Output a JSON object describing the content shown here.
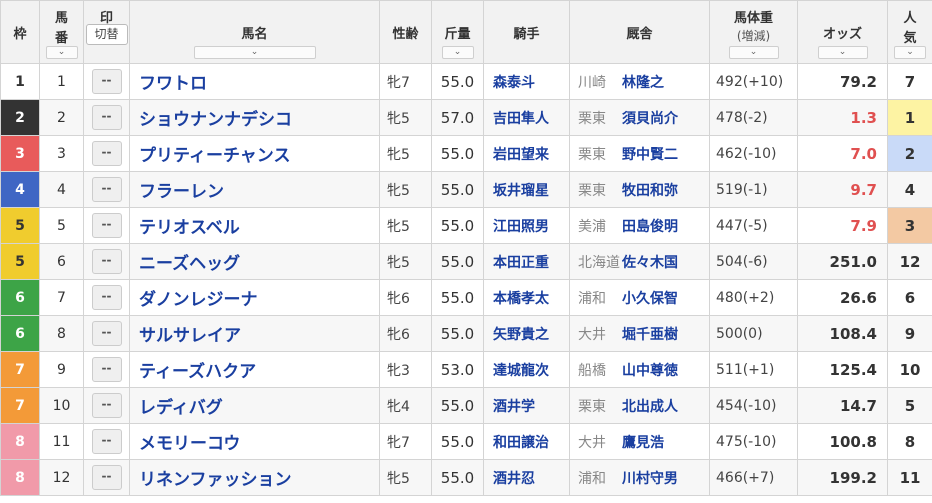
{
  "header": {
    "waku": "枠",
    "umaban_1": "馬",
    "umaban_2": "番",
    "mark": "印",
    "mark_toggle": "切替",
    "horse": "馬名",
    "sexage": "性齢",
    "weight": "斤量",
    "jockey": "騎手",
    "stable": "厩舎",
    "body_1": "馬体重",
    "body_2": "(増減)",
    "odds": "オッズ",
    "pop_1": "人",
    "pop_2": "気",
    "sort_glyph": "⌄"
  },
  "colors": {
    "waku_1": "#ffffff",
    "waku_2": "#333333",
    "waku_3": "#e85b5b",
    "waku_4": "#3f66c4",
    "waku_5": "#f0cc2e",
    "waku_6": "#3da447",
    "waku_7": "#f39a38",
    "waku_8": "#f19aa9",
    "pop_1": "#fdf3a3",
    "pop_2": "#c9daf8",
    "pop_3": "#f3c9a3"
  },
  "rows": [
    {
      "waku": "1",
      "umaban": "1",
      "mark": "--",
      "horse": "フワトロ",
      "sexage": "牝7",
      "weight": "55.0",
      "jockey": "森泰斗",
      "region": "川崎",
      "trainer": "林隆之",
      "body": "492(+10)",
      "odds": "79.2",
      "hot": false,
      "pop": "7"
    },
    {
      "waku": "2",
      "umaban": "2",
      "mark": "--",
      "horse": "ショウナンナデシコ",
      "sexage": "牝5",
      "weight": "57.0",
      "jockey": "吉田隼人",
      "region": "栗東",
      "trainer": "須貝尚介",
      "body": "478(-2)",
      "odds": "1.3",
      "hot": true,
      "pop": "1"
    },
    {
      "waku": "3",
      "umaban": "3",
      "mark": "--",
      "horse": "プリティーチャンス",
      "sexage": "牝5",
      "weight": "55.0",
      "jockey": "岩田望来",
      "region": "栗東",
      "trainer": "野中賢二",
      "body": "462(-10)",
      "odds": "7.0",
      "hot": true,
      "pop": "2"
    },
    {
      "waku": "4",
      "umaban": "4",
      "mark": "--",
      "horse": "フラーレン",
      "sexage": "牝5",
      "weight": "55.0",
      "jockey": "坂井瑠星",
      "region": "栗東",
      "trainer": "牧田和弥",
      "body": "519(-1)",
      "odds": "9.7",
      "hot": true,
      "pop": "4"
    },
    {
      "waku": "5",
      "umaban": "5",
      "mark": "--",
      "horse": "テリオスベル",
      "sexage": "牝5",
      "weight": "55.0",
      "jockey": "江田照男",
      "region": "美浦",
      "trainer": "田島俊明",
      "body": "447(-5)",
      "odds": "7.9",
      "hot": true,
      "pop": "3"
    },
    {
      "waku": "5",
      "umaban": "6",
      "mark": "--",
      "horse": "ニーズヘッグ",
      "sexage": "牝5",
      "weight": "55.0",
      "jockey": "本田正重",
      "region": "北海道",
      "trainer": "佐々木国",
      "body": "504(-6)",
      "odds": "251.0",
      "hot": false,
      "pop": "12"
    },
    {
      "waku": "6",
      "umaban": "7",
      "mark": "--",
      "horse": "ダノンレジーナ",
      "sexage": "牝6",
      "weight": "55.0",
      "jockey": "本橋孝太",
      "region": "浦和",
      "trainer": "小久保智",
      "body": "480(+2)",
      "odds": "26.6",
      "hot": false,
      "pop": "6"
    },
    {
      "waku": "6",
      "umaban": "8",
      "mark": "--",
      "horse": "サルサレイア",
      "sexage": "牝6",
      "weight": "55.0",
      "jockey": "矢野貴之",
      "region": "大井",
      "trainer": "堀千亜樹",
      "body": "500(0)",
      "odds": "108.4",
      "hot": false,
      "pop": "9"
    },
    {
      "waku": "7",
      "umaban": "9",
      "mark": "--",
      "horse": "ティーズハクア",
      "sexage": "牝3",
      "weight": "53.0",
      "jockey": "達城龍次",
      "region": "船橋",
      "trainer": "山中尊徳",
      "body": "511(+1)",
      "odds": "125.4",
      "hot": false,
      "pop": "10"
    },
    {
      "waku": "7",
      "umaban": "10",
      "mark": "--",
      "horse": "レディバグ",
      "sexage": "牝4",
      "weight": "55.0",
      "jockey": "酒井学",
      "region": "栗東",
      "trainer": "北出成人",
      "body": "454(-10)",
      "odds": "14.7",
      "hot": false,
      "pop": "5"
    },
    {
      "waku": "8",
      "umaban": "11",
      "mark": "--",
      "horse": "メモリーコウ",
      "sexage": "牝7",
      "weight": "55.0",
      "jockey": "和田譲治",
      "region": "大井",
      "trainer": "鷹見浩",
      "body": "475(-10)",
      "odds": "100.8",
      "hot": false,
      "pop": "8"
    },
    {
      "waku": "8",
      "umaban": "12",
      "mark": "--",
      "horse": "リネンファッション",
      "sexage": "牝5",
      "weight": "55.0",
      "jockey": "酒井忍",
      "region": "浦和",
      "trainer": "川村守男",
      "body": "466(+7)",
      "odds": "199.2",
      "hot": false,
      "pop": "11"
    }
  ]
}
